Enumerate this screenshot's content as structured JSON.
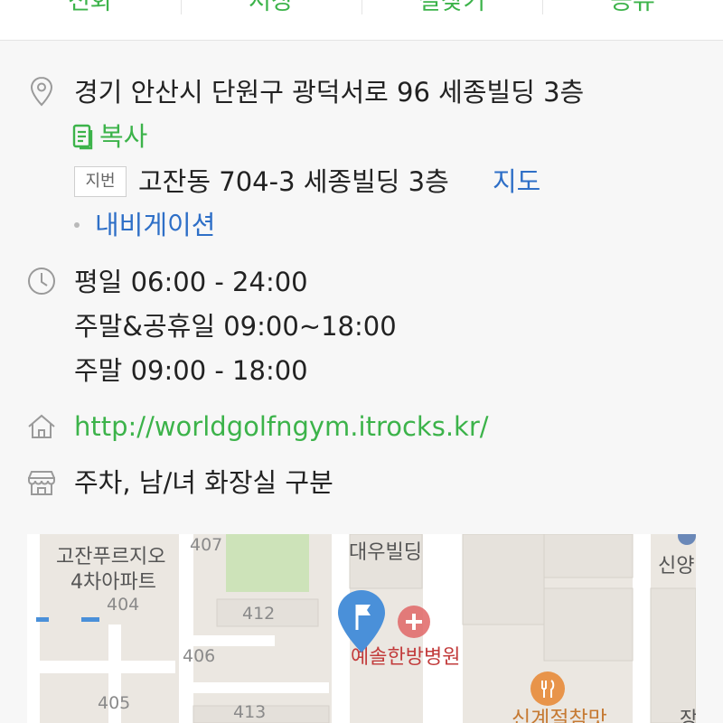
{
  "top_tabs": [
    {
      "label": "전화",
      "icon": "phone-icon"
    },
    {
      "label": "저장",
      "icon": "star-icon"
    },
    {
      "label": "길찾기",
      "icon": "directions-icon"
    },
    {
      "label": "공유",
      "icon": "share-icon"
    }
  ],
  "address": {
    "icon": "location-pin-icon",
    "road": "경기 안산시 단원구 광덕서로 96 세종빌딩 3층",
    "copy_label": "복사",
    "copy_icon": "copy-icon",
    "jibun_badge": "지번",
    "jibun": "고잔동 704-3 세종빌딩 3층",
    "map_link": "지도",
    "navigation_link": "내비게이션"
  },
  "hours": {
    "icon": "clock-icon",
    "lines": [
      "평일 06:00 - 24:00",
      "주말&공휴일 09:00~18:00",
      "주말 09:00 - 18:00"
    ]
  },
  "website": {
    "icon": "home-icon",
    "url": "http://worldgolfngym.itrocks.kr/"
  },
  "facilities": {
    "icon": "store-icon",
    "text": "주차, 남/녀 화장실 구분"
  },
  "map": {
    "labels": {
      "building1": "고잔푸르지오",
      "building1b": "4차아파트",
      "daewoo": "대우빌딩",
      "clinic": "예솔한방병원",
      "shinyang": "신양",
      "restaurant": "신계절참맛",
      "edge": "장"
    },
    "numbers": [
      "407",
      "404",
      "412",
      "406",
      "405",
      "413"
    ],
    "colors": {
      "pin": "#4a90d9",
      "hospital": "#e06666",
      "food": "#e8944a",
      "park": "#cde3b9",
      "clinic_text": "#c23b3b"
    }
  },
  "colors": {
    "accent_green": "#3cb34a",
    "link_blue": "#2e6fc7"
  }
}
